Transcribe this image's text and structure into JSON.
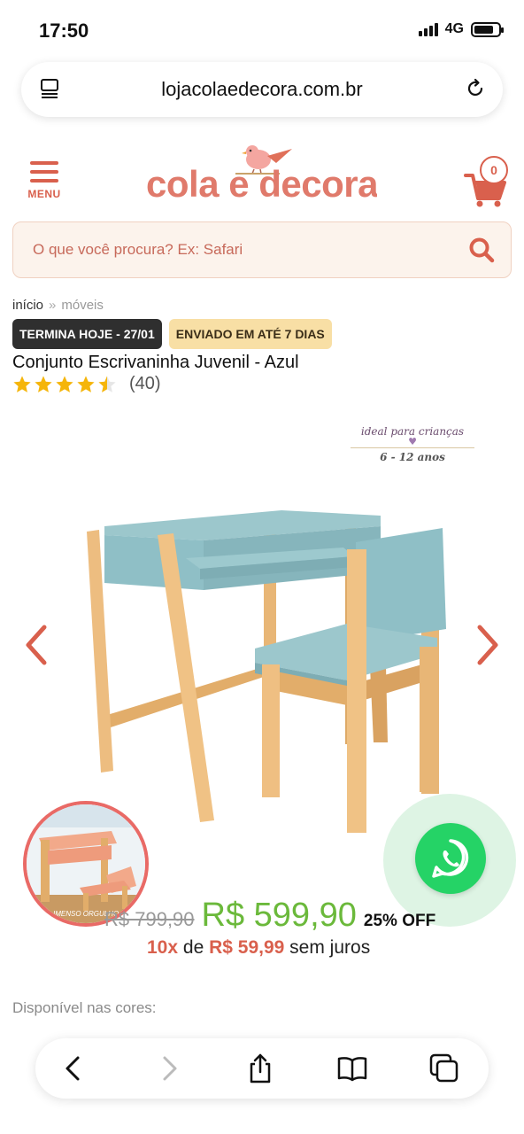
{
  "status_bar": {
    "time": "17:50",
    "network": "4G"
  },
  "browser": {
    "url": "lojacolaedecora.com.br"
  },
  "header": {
    "menu_label": "MENU",
    "logo_text": "cola e decora",
    "cart_count": "0"
  },
  "search": {
    "placeholder": "O que você procura? Ex: Safari"
  },
  "breadcrumb": {
    "home": "início",
    "separator": "»",
    "current": "móveis"
  },
  "tags": {
    "deadline": "TERMINA HOJE - 27/01",
    "shipping": "ENVIADO EM ATÉ 7 DIAS"
  },
  "product": {
    "title": "Conjunto Escrivaninha Juvenil - Azul",
    "rating": 4.5,
    "review_count": "(40)",
    "badge_line1": "ideal para crianças",
    "badge_line2": "6 - 12 anos",
    "thumb_caption": "IMENSO ORGULHO",
    "old_price": "R$ 799,90",
    "new_price": "R$ 599,90",
    "discount": "25% OFF",
    "installments_count": "10x",
    "installments_of": "de",
    "installment_value": "R$ 59,99",
    "installments_suffix": "sem juros",
    "colors_label": "Disponível nas cores:"
  },
  "colors": {
    "brand": "#d9604d",
    "price_green": "#6bb93b",
    "whatsapp": "#25d366",
    "desk_blue": "#8fbfc6",
    "wood": "#e8b676"
  },
  "icons": {
    "tabs": "tabs-icon",
    "reload": "reload-icon",
    "menu": "hamburger-icon",
    "cart": "cart-icon",
    "search": "search-icon",
    "prev": "chevron-left-icon",
    "next": "chevron-right-icon",
    "whatsapp": "whatsapp-icon",
    "back": "back-icon",
    "forward": "forward-icon",
    "share": "share-icon",
    "bookmarks": "book-icon",
    "tabs_overview": "tabs-overview-icon"
  }
}
